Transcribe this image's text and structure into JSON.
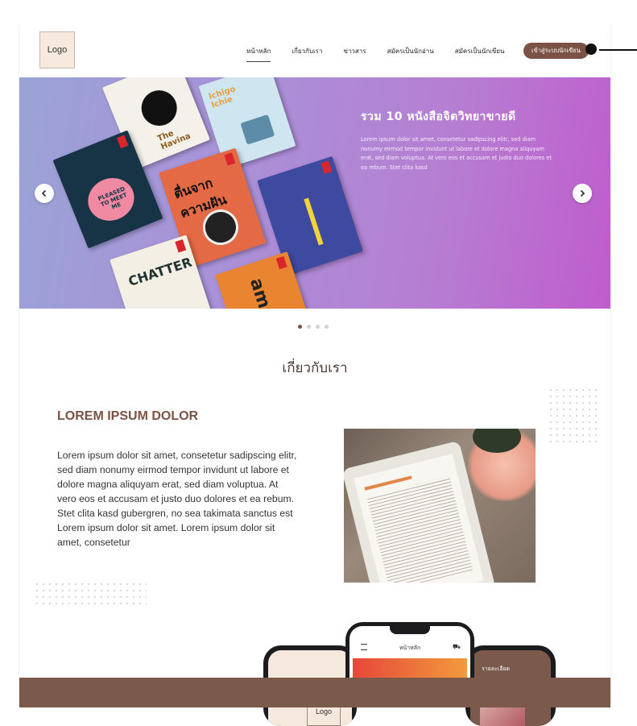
{
  "header": {
    "logo": "Logo",
    "nav": [
      "หน้าหลัก",
      "เกี่ยวกับเรา",
      "ข่าวสาร",
      "สมัครเป็นนักอ่าน",
      "สมัครเป็นนักเขียน"
    ],
    "active_index": 0,
    "login_label": "เข้าสู่ระบบนักเขียน"
  },
  "hero": {
    "title": "รวม 10 หนังสือจิตวิทยาขายดี",
    "description": "Lorem ipsum dolor sit amet, consetetur sadipscing elitr, sed diam nonumy eirmod tempor invidunt ut labore et dolore magna aliquyam erat, sed diam voluptua. At vero eos et accusam et justo duo dolores et ea rebum. Stet clita kasd",
    "books": [
      {
        "text": "The Havina"
      },
      {
        "text": "Ichigo Ichie"
      },
      {
        "text": "PLEASED TO MEET ME"
      },
      {
        "text": "ตื่นจากความฝัน"
      },
      {
        "text": "CHATTER"
      },
      {
        "text": "ama"
      }
    ],
    "slide_count": 4,
    "active_slide": 0
  },
  "about": {
    "section_title": "เกี่ยวกับเรา",
    "heading": "LOREM IPSUM DOLOR",
    "body": "Lorem ipsum dolor sit amet, consetetur sadipscing elitr, sed diam nonumy eirmod tempor invidunt ut labore et dolore magna aliquyam erat, sed diam voluptua. At vero eos et accusam et justo duo dolores et ea rebum. Stet clita kasd gubergren, no sea takimata sanctus est Lorem ipsum dolor sit amet. Lorem ipsum dolor sit amet, consetetur"
  },
  "phones": {
    "left_logo": "Logo",
    "center_title": "หน้าหลัก",
    "right_title": "รายละเอียด"
  },
  "colors": {
    "brand": "#7b5245",
    "band": "#7b5a4c",
    "logo_bg": "#f7e9dd"
  }
}
